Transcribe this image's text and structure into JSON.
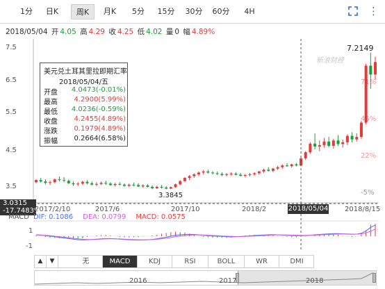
{
  "toolbar": {
    "tabs": [
      {
        "label": "1分",
        "active": false
      },
      {
        "label": "日K",
        "active": false
      },
      {
        "label": "周K",
        "active": true
      },
      {
        "label": "月K",
        "active": false
      },
      {
        "label": "5分",
        "active": false
      },
      {
        "label": "15分",
        "active": false
      },
      {
        "label": "30分",
        "active": false
      },
      {
        "label": "60分",
        "active": false
      },
      {
        "label": "4H",
        "active": false
      }
    ],
    "fullscreen_icon": "fullscreen-icon",
    "more_icon": "more-dots-icon",
    "accent": "#2b6fd6"
  },
  "quote": {
    "date": "2018/05/04",
    "open_label": "开",
    "open": "4.05",
    "high_label": "高",
    "high": "4.29",
    "close_label": "收",
    "close": "4.25",
    "low_label": "低",
    "low": "4.02",
    "volume_label": "量",
    "volume": "0",
    "amp_label": "幅",
    "amp": "4.89%"
  },
  "tooltip": {
    "title": "美元兑土耳其里拉即期汇率",
    "date": "2018/05/04/五",
    "rows": [
      {
        "k": "开盘",
        "v": "4.0473(-0.01%)",
        "color": "#1f9c3a"
      },
      {
        "k": "最高",
        "v": "4.2900(5.99%)",
        "color": "#e23b3b"
      },
      {
        "k": "最低",
        "v": "4.0236(-0.59%)",
        "color": "#1f9c3a"
      },
      {
        "k": "收盘",
        "v": "4.2455(4.89%)",
        "color": "#e23b3b"
      },
      {
        "k": "涨跌",
        "v": "0.1979(4.89%)",
        "color": "#e23b3b"
      },
      {
        "k": "振幅",
        "v": "0.2664(6.58%)",
        "color": "#222222"
      }
    ]
  },
  "markers": {
    "max_label": "7.2149",
    "min_label": "3.3845",
    "price_box_top": "3.0315",
    "price_box_bottom": "-17.7483%",
    "crosshair_date": "2018/05/04",
    "watermark": "新浪财经"
  },
  "colors": {
    "up": "#e23b3b",
    "down": "#1f9c3a"
  },
  "macd": {
    "label": "MACD",
    "dif_label": "DIF: 0.1086",
    "dea_label": "DEA: 0.0799",
    "macd_label": "MACD: 0.0575",
    "yticks": [
      "1",
      "-1"
    ]
  },
  "indicators": {
    "items": [
      {
        "label": "无",
        "active": false
      },
      {
        "label": "MACD",
        "active": true
      },
      {
        "label": "KDJ",
        "active": false
      },
      {
        "label": "RSI",
        "active": false
      },
      {
        "label": "BOLL",
        "active": false
      },
      {
        "label": "WR",
        "active": false
      },
      {
        "label": "DMI",
        "active": false
      }
    ],
    "prev_icon": "arrow-up-icon",
    "next_icon": "arrow-down-icon"
  },
  "navigator": {
    "labels": [
      "2016",
      "2017",
      "2018"
    ]
  },
  "chart_data": {
    "type": "candlestick",
    "title": "",
    "xlabel": "",
    "ylabel": "",
    "ylim": [
      3.0,
      7.6
    ],
    "yticks": [
      7.5,
      6.5,
      5.5,
      4.5,
      3.5
    ],
    "pct_ticks": [
      "71%",
      "46%",
      "22%",
      "-5%"
    ],
    "xticks": [
      "2017/2/10",
      "2017/6",
      "2017/10",
      "2018/2",
      "2018/8/15"
    ],
    "grid": false,
    "candles": [
      {
        "o": 3.58,
        "h": 3.66,
        "l": 3.55,
        "c": 3.64
      },
      {
        "o": 3.64,
        "h": 3.7,
        "l": 3.57,
        "c": 3.6
      },
      {
        "o": 3.6,
        "h": 3.66,
        "l": 3.52,
        "c": 3.56
      },
      {
        "o": 3.56,
        "h": 3.62,
        "l": 3.5,
        "c": 3.58
      },
      {
        "o": 3.58,
        "h": 3.68,
        "l": 3.55,
        "c": 3.66
      },
      {
        "o": 3.66,
        "h": 3.74,
        "l": 3.6,
        "c": 3.64
      },
      {
        "o": 3.64,
        "h": 3.72,
        "l": 3.58,
        "c": 3.62
      },
      {
        "o": 3.62,
        "h": 3.66,
        "l": 3.53,
        "c": 3.55
      },
      {
        "o": 3.55,
        "h": 3.6,
        "l": 3.48,
        "c": 3.52
      },
      {
        "o": 3.52,
        "h": 3.58,
        "l": 3.47,
        "c": 3.54
      },
      {
        "o": 3.54,
        "h": 3.62,
        "l": 3.5,
        "c": 3.59
      },
      {
        "o": 3.59,
        "h": 3.64,
        "l": 3.52,
        "c": 3.55
      },
      {
        "o": 3.55,
        "h": 3.6,
        "l": 3.49,
        "c": 3.51
      },
      {
        "o": 3.51,
        "h": 3.58,
        "l": 3.47,
        "c": 3.53
      },
      {
        "o": 3.53,
        "h": 3.6,
        "l": 3.5,
        "c": 3.56
      },
      {
        "o": 3.56,
        "h": 3.62,
        "l": 3.5,
        "c": 3.54
      },
      {
        "o": 3.54,
        "h": 3.58,
        "l": 3.48,
        "c": 3.5
      },
      {
        "o": 3.5,
        "h": 3.56,
        "l": 3.46,
        "c": 3.53
      },
      {
        "o": 3.53,
        "h": 3.58,
        "l": 3.49,
        "c": 3.51
      },
      {
        "o": 3.51,
        "h": 3.55,
        "l": 3.45,
        "c": 3.48
      },
      {
        "o": 3.48,
        "h": 3.54,
        "l": 3.44,
        "c": 3.51
      },
      {
        "o": 3.51,
        "h": 3.57,
        "l": 3.46,
        "c": 3.5
      },
      {
        "o": 3.5,
        "h": 3.55,
        "l": 3.44,
        "c": 3.46
      },
      {
        "o": 3.46,
        "h": 3.52,
        "l": 3.42,
        "c": 3.49
      },
      {
        "o": 3.49,
        "h": 3.53,
        "l": 3.43,
        "c": 3.45
      },
      {
        "o": 3.45,
        "h": 3.49,
        "l": 3.38,
        "c": 3.41
      },
      {
        "o": 3.41,
        "h": 3.48,
        "l": 3.39,
        "c": 3.45
      },
      {
        "o": 3.45,
        "h": 3.5,
        "l": 3.4,
        "c": 3.43
      },
      {
        "o": 3.43,
        "h": 3.47,
        "l": 3.38,
        "c": 3.4
      },
      {
        "o": 3.4,
        "h": 3.46,
        "l": 3.3845,
        "c": 3.44
      },
      {
        "o": 3.44,
        "h": 3.54,
        "l": 3.42,
        "c": 3.52
      },
      {
        "o": 3.52,
        "h": 3.64,
        "l": 3.49,
        "c": 3.61
      },
      {
        "o": 3.61,
        "h": 3.72,
        "l": 3.58,
        "c": 3.7
      },
      {
        "o": 3.7,
        "h": 3.78,
        "l": 3.64,
        "c": 3.75
      },
      {
        "o": 3.75,
        "h": 3.83,
        "l": 3.7,
        "c": 3.8
      },
      {
        "o": 3.8,
        "h": 3.88,
        "l": 3.75,
        "c": 3.85
      },
      {
        "o": 3.85,
        "h": 3.92,
        "l": 3.8,
        "c": 3.88
      },
      {
        "o": 3.88,
        "h": 3.93,
        "l": 3.82,
        "c": 3.85
      },
      {
        "o": 3.85,
        "h": 3.89,
        "l": 3.8,
        "c": 3.83
      },
      {
        "o": 3.83,
        "h": 3.88,
        "l": 3.78,
        "c": 3.81
      },
      {
        "o": 3.81,
        "h": 3.86,
        "l": 3.75,
        "c": 3.78
      },
      {
        "o": 3.78,
        "h": 3.84,
        "l": 3.74,
        "c": 3.8
      },
      {
        "o": 3.8,
        "h": 3.86,
        "l": 3.76,
        "c": 3.82
      },
      {
        "o": 3.82,
        "h": 3.86,
        "l": 3.77,
        "c": 3.79
      },
      {
        "o": 3.79,
        "h": 3.84,
        "l": 3.74,
        "c": 3.76
      },
      {
        "o": 3.76,
        "h": 3.81,
        "l": 3.72,
        "c": 3.78
      },
      {
        "o": 3.78,
        "h": 3.84,
        "l": 3.74,
        "c": 3.8
      },
      {
        "o": 3.8,
        "h": 3.86,
        "l": 3.76,
        "c": 3.83
      },
      {
        "o": 3.83,
        "h": 3.9,
        "l": 3.79,
        "c": 3.88
      },
      {
        "o": 3.88,
        "h": 3.96,
        "l": 3.84,
        "c": 3.93
      },
      {
        "o": 3.93,
        "h": 4.0,
        "l": 3.88,
        "c": 3.9
      },
      {
        "o": 3.9,
        "h": 3.98,
        "l": 3.86,
        "c": 3.96
      },
      {
        "o": 3.96,
        "h": 4.04,
        "l": 3.92,
        "c": 4.0
      },
      {
        "o": 4.0,
        "h": 4.08,
        "l": 3.96,
        "c": 4.05
      },
      {
        "o": 4.05,
        "h": 4.12,
        "l": 4.01,
        "c": 4.03
      },
      {
        "o": 4.03,
        "h": 4.1,
        "l": 3.99,
        "c": 4.08
      },
      {
        "o": 4.08,
        "h": 4.12,
        "l": 4.02,
        "c": 4.05
      },
      {
        "o": 4.0473,
        "h": 4.29,
        "l": 4.0236,
        "c": 4.2455
      },
      {
        "o": 4.25,
        "h": 4.45,
        "l": 4.2,
        "c": 4.42
      },
      {
        "o": 4.42,
        "h": 4.7,
        "l": 4.38,
        "c": 4.66
      },
      {
        "o": 4.66,
        "h": 4.95,
        "l": 4.5,
        "c": 4.58
      },
      {
        "o": 4.58,
        "h": 4.75,
        "l": 4.45,
        "c": 4.62
      },
      {
        "o": 4.62,
        "h": 4.82,
        "l": 4.55,
        "c": 4.72
      },
      {
        "o": 4.72,
        "h": 4.85,
        "l": 4.56,
        "c": 4.6
      },
      {
        "o": 4.6,
        "h": 4.8,
        "l": 4.52,
        "c": 4.75
      },
      {
        "o": 4.75,
        "h": 4.9,
        "l": 4.6,
        "c": 4.65
      },
      {
        "o": 4.65,
        "h": 4.78,
        "l": 4.55,
        "c": 4.7
      },
      {
        "o": 4.7,
        "h": 4.92,
        "l": 4.62,
        "c": 4.88
      },
      {
        "o": 4.88,
        "h": 4.98,
        "l": 4.7,
        "c": 4.78
      },
      {
        "o": 4.78,
        "h": 4.95,
        "l": 4.72,
        "c": 4.85
      },
      {
        "o": 4.85,
        "h": 5.3,
        "l": 4.8,
        "c": 5.25
      },
      {
        "o": 5.25,
        "h": 6.9,
        "l": 5.2,
        "c": 6.85
      },
      {
        "o": 6.85,
        "h": 7.2149,
        "l": 6.2,
        "c": 6.6
      },
      {
        "o": 6.6,
        "h": 7.1,
        "l": 6.45,
        "c": 6.95
      }
    ],
    "macd": {
      "ylim": [
        -1.3,
        1.3
      ],
      "dif": [
        0.12,
        0.1,
        0.05,
        0.0,
        -0.05,
        -0.1,
        -0.15,
        -0.2,
        -0.25,
        -0.3,
        -0.32,
        -0.3,
        -0.28,
        -0.25,
        -0.22,
        -0.2,
        -0.2,
        -0.22,
        -0.25,
        -0.28,
        -0.3,
        -0.32,
        -0.33,
        -0.32,
        -0.3,
        -0.27,
        -0.22,
        -0.15,
        -0.08,
        0.0,
        0.08,
        0.12,
        0.15,
        0.16,
        0.15,
        0.12,
        0.08,
        0.05,
        0.02,
        0.0,
        -0.02,
        -0.05,
        -0.06,
        -0.05,
        -0.03,
        0.0,
        0.03,
        0.06,
        0.08,
        0.1,
        0.12,
        0.13,
        0.12,
        0.1,
        0.08,
        0.06,
        0.05,
        0.05,
        0.06,
        0.08,
        0.12,
        0.15,
        0.18,
        0.2,
        0.22,
        0.22,
        0.2,
        0.18,
        0.16,
        0.18,
        0.25,
        0.45,
        0.75,
        0.95
      ],
      "dea": [
        0.1,
        0.09,
        0.07,
        0.04,
        0.0,
        -0.04,
        -0.09,
        -0.13,
        -0.18,
        -0.22,
        -0.26,
        -0.28,
        -0.28,
        -0.27,
        -0.25,
        -0.23,
        -0.22,
        -0.22,
        -0.23,
        -0.25,
        -0.27,
        -0.29,
        -0.3,
        -0.31,
        -0.3,
        -0.29,
        -0.26,
        -0.22,
        -0.17,
        -0.11,
        -0.05,
        0.01,
        0.05,
        0.09,
        0.11,
        0.11,
        0.1,
        0.08,
        0.06,
        0.04,
        0.02,
        0.0,
        -0.02,
        -0.03,
        -0.03,
        -0.02,
        0.0,
        0.02,
        0.04,
        0.06,
        0.08,
        0.1,
        0.11,
        0.11,
        0.1,
        0.09,
        0.08,
        0.07,
        0.07,
        0.08,
        0.09,
        0.11,
        0.13,
        0.15,
        0.17,
        0.18,
        0.19,
        0.19,
        0.18,
        0.18,
        0.2,
        0.28,
        0.42,
        0.6
      ],
      "hist": [
        0.02,
        0.01,
        -0.02,
        -0.04,
        -0.05,
        -0.06,
        -0.06,
        -0.07,
        -0.07,
        -0.08,
        -0.06,
        -0.02,
        0.0,
        0.02,
        0.03,
        0.03,
        0.02,
        0.0,
        -0.02,
        -0.03,
        -0.03,
        -0.03,
        -0.03,
        -0.01,
        0.0,
        0.02,
        0.04,
        0.07,
        0.09,
        0.11,
        0.13,
        0.11,
        0.1,
        0.07,
        0.04,
        0.01,
        -0.02,
        -0.03,
        -0.04,
        -0.04,
        -0.04,
        -0.05,
        -0.04,
        -0.02,
        0.0,
        0.02,
        0.03,
        0.04,
        0.04,
        0.04,
        0.04,
        0.03,
        0.01,
        -0.01,
        -0.02,
        -0.03,
        -0.03,
        -0.02,
        -0.01,
        0.0,
        0.03,
        0.04,
        0.05,
        0.05,
        0.05,
        0.04,
        0.01,
        -0.01,
        -0.02,
        0.0,
        0.05,
        0.17,
        0.33,
        0.35
      ]
    }
  }
}
